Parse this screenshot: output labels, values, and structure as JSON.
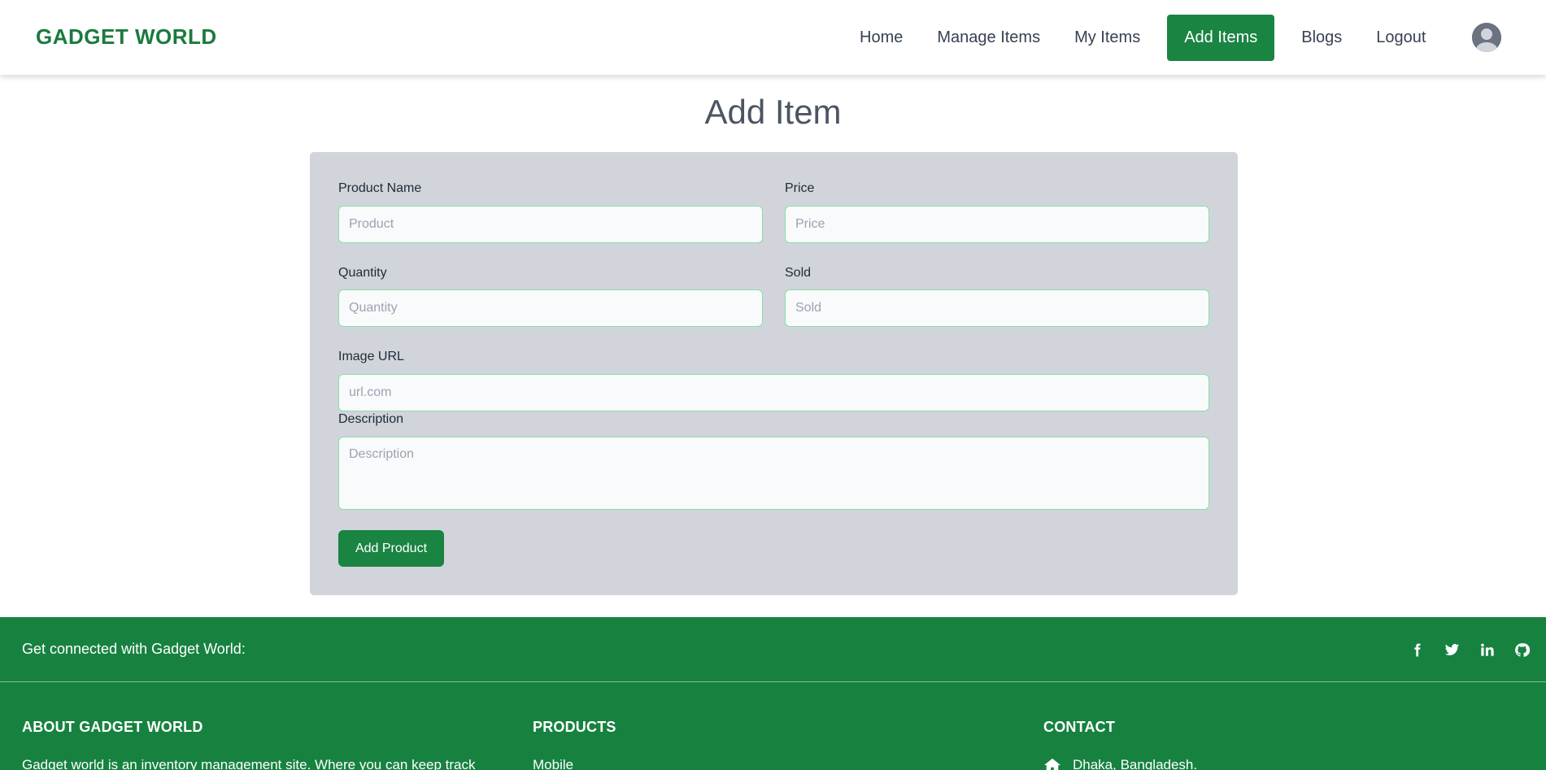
{
  "navbar": {
    "brand": "GADGET WORLD",
    "links": [
      "Home",
      "Manage Items",
      "My Items",
      "Add Items",
      "Blogs",
      "Logout"
    ],
    "active_link": "Add Items"
  },
  "page": {
    "title": "Add Item"
  },
  "form": {
    "product_name": {
      "label": "Product Name",
      "placeholder": "Product",
      "value": ""
    },
    "price": {
      "label": "Price",
      "placeholder": "Price",
      "value": ""
    },
    "quantity": {
      "label": "Quantity",
      "placeholder": "Quantity",
      "value": ""
    },
    "sold": {
      "label": "Sold",
      "placeholder": "Sold",
      "value": ""
    },
    "image_url": {
      "label": "Image URL",
      "placeholder": "url.com",
      "value": ""
    },
    "description": {
      "label": "Description",
      "placeholder": "Description",
      "value": ""
    },
    "submit_label": "Add Product"
  },
  "footer": {
    "connect_text": "Get connected with Gadget World:",
    "socials": [
      "facebook-icon",
      "twitter-icon",
      "linkedin-icon",
      "github-icon"
    ],
    "about": {
      "heading": "ABOUT GADGET WORLD",
      "text": "Gadget world is an inventory management site. Where you can keep track"
    },
    "products": {
      "heading": "PRODUCTS",
      "first_item": "Mobile"
    },
    "contact": {
      "heading": "CONTACT",
      "address": "Dhaka, Bangladesh."
    }
  },
  "colors": {
    "brand_green": "#1a8443",
    "footer_green": "#178240",
    "card_gray": "#d1d5db",
    "input_border": "#86e0a5"
  }
}
